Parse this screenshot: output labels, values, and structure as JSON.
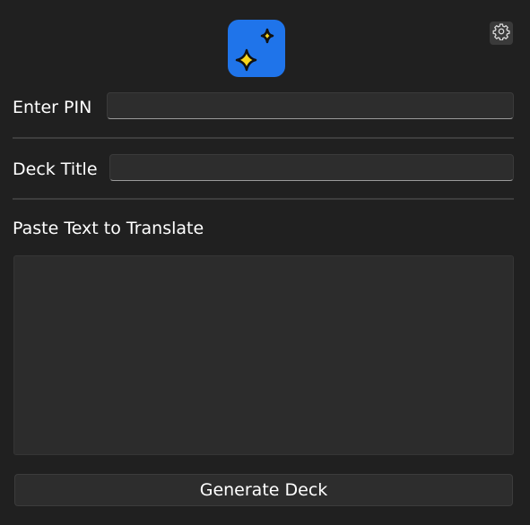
{
  "app": {
    "logo_icon": "sparkles-icon",
    "logo_bg": "#1f74ea",
    "settings_icon": "gear-icon"
  },
  "pin": {
    "label": "Enter PIN",
    "value": "",
    "placeholder": ""
  },
  "deck_title": {
    "label": "Deck Title",
    "value": "",
    "placeholder": ""
  },
  "translate": {
    "label": "Paste Text to Translate",
    "value": "",
    "placeholder": ""
  },
  "actions": {
    "generate_label": "Generate Deck"
  }
}
